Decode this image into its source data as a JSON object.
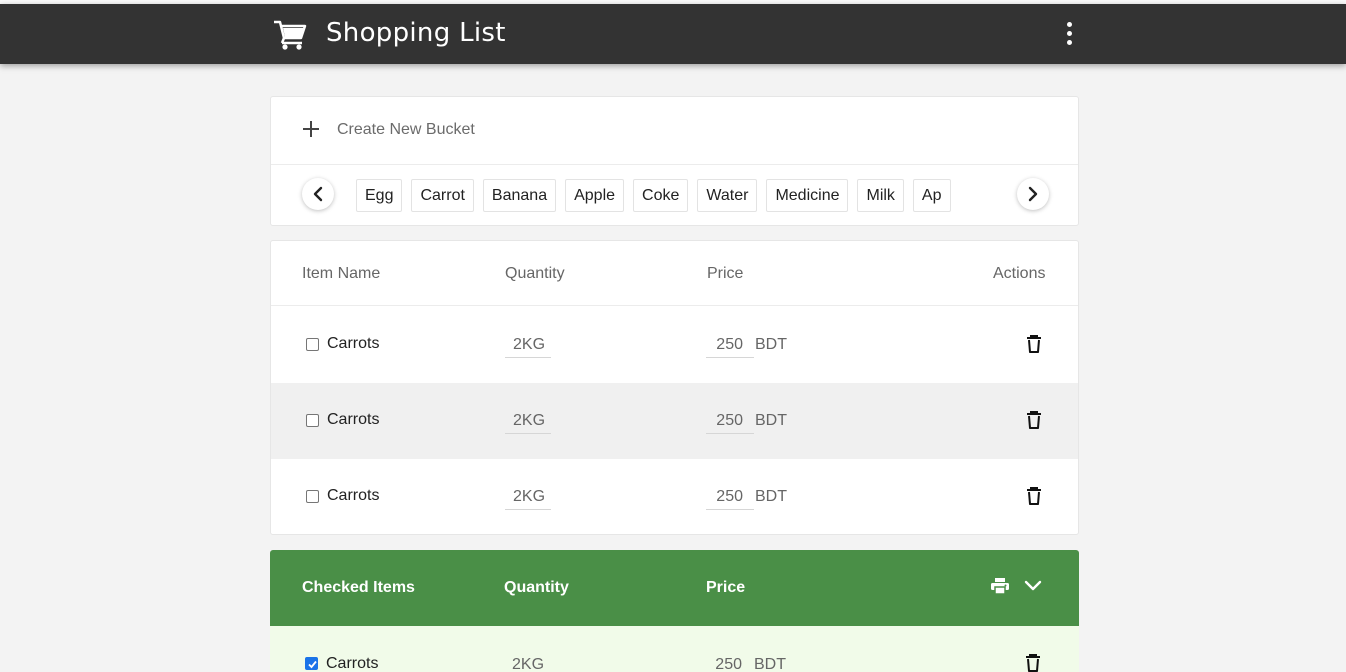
{
  "app": {
    "title": "Shopping List",
    "icons": {
      "cart": "cart-icon",
      "menu": "more-vertical-icon"
    }
  },
  "bucket": {
    "create_label": "Create New Bucket",
    "chips": [
      "Egg",
      "Carrot",
      "Banana",
      "Apple",
      "Coke",
      "Water",
      "Medicine",
      "Milk",
      "Ap"
    ]
  },
  "table": {
    "headers": {
      "item_name": "Item Name",
      "quantity": "Quantity",
      "price": "Price",
      "actions": "Actions"
    },
    "rows": [
      {
        "checked": false,
        "name": "Carrots",
        "quantity": "2KG",
        "price": "250",
        "currency": "BDT"
      },
      {
        "checked": false,
        "name": "Carrots",
        "quantity": "2KG",
        "price": "250",
        "currency": "BDT"
      },
      {
        "checked": false,
        "name": "Carrots",
        "quantity": "2KG",
        "price": "250",
        "currency": "BDT"
      }
    ]
  },
  "checked_section": {
    "headers": {
      "item_name": "Checked Items",
      "quantity": "Quantity",
      "price": "Price"
    },
    "rows": [
      {
        "checked": true,
        "name": "Carrots",
        "quantity": "2KG",
        "price": "250",
        "currency": "BDT"
      }
    ]
  },
  "colors": {
    "appbar": "#333333",
    "checked_header": "#4a8f47",
    "checked_row": "#f1fbe9",
    "checkbox_accent": "#1a73e8"
  }
}
